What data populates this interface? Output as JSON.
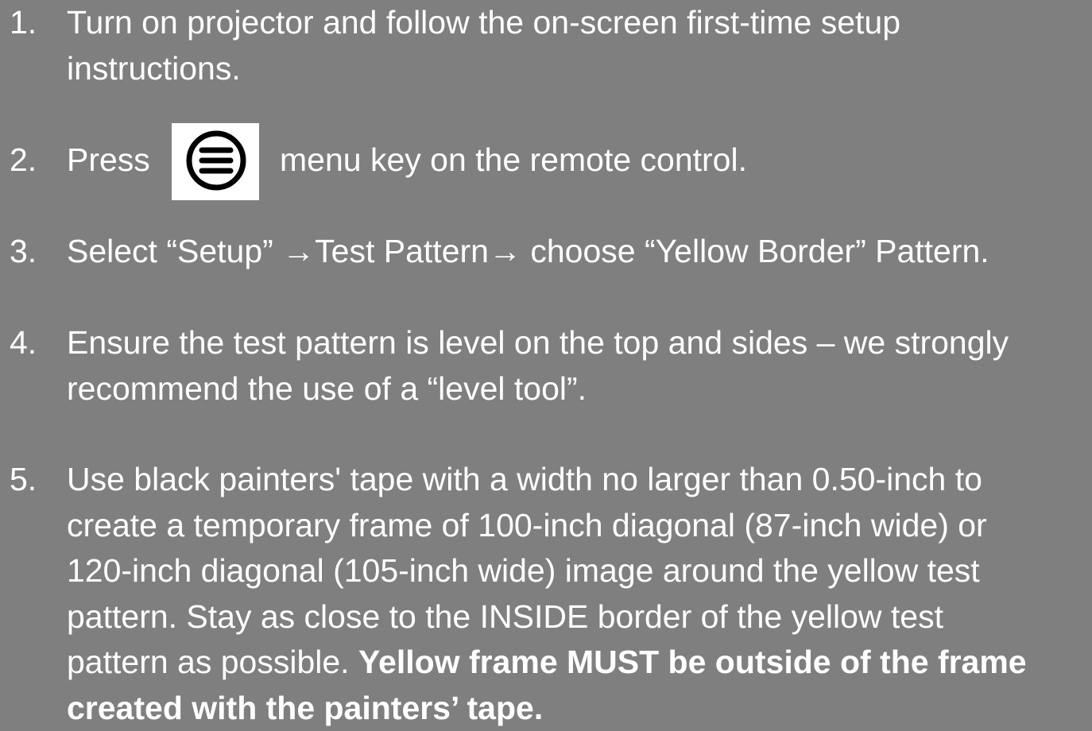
{
  "instructions": [
    {
      "number": "1.",
      "lines": [
        "Turn on projector and follow the on-screen first-time setup",
        "instructions."
      ]
    },
    {
      "number": "2.",
      "before_icon": "Press",
      "icon": "menu-icon",
      "after_icon": "menu key on the remote control."
    },
    {
      "number": "3.",
      "lines": [
        "Select “Setup” →Test Pattern→ choose “Yellow Border” Pattern."
      ]
    },
    {
      "number": "4.",
      "lines": [
        "Ensure the test pattern is level on the top and sides – we strongly",
        "recommend the use of a “level tool”."
      ]
    },
    {
      "number": "5.",
      "lines": [
        "Use black painters' tape with a width no larger than 0.50-inch to",
        "create a temporary frame of 100-inch diagonal (87-inch wide) or",
        "120-inch diagonal (105-inch wide) image around the yellow test",
        "pattern. Stay as close to the INSIDE border of the yellow test"
      ],
      "mixed_line_normal": "pattern as possible. ",
      "mixed_line_bold": "Yellow frame MUST be outside of the frame",
      "bold_line": "created with the painters’ tape."
    }
  ],
  "colors": {
    "background": "#7f7f7f",
    "text": "#ffffff",
    "icon_box": "#ffffff",
    "icon": "#000000"
  }
}
